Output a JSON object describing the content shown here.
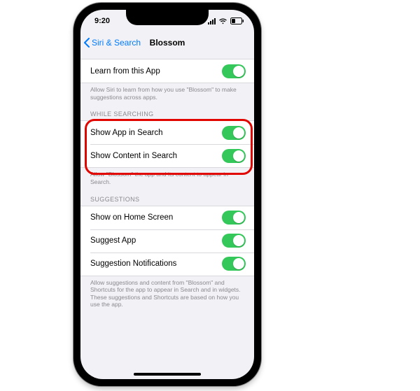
{
  "statusbar": {
    "time": "9:20"
  },
  "nav": {
    "back_label": "Siri & Search",
    "title": "Blossom"
  },
  "learn_section": {
    "row_label": "Learn from this App",
    "footer": "Allow Siri to learn from how you use \"Blossom\" to make suggestions across apps."
  },
  "searching_section": {
    "header": "WHILE SEARCHING",
    "rows": {
      "show_app": "Show App in Search",
      "show_content": "Show Content in Search"
    },
    "footer": "Allow \"Blossom\" the app and its content to appear in Search."
  },
  "suggestions_section": {
    "header": "SUGGESTIONS",
    "rows": {
      "home": "Show on Home Screen",
      "suggest": "Suggest App",
      "notifications": "Suggestion Notifications"
    },
    "footer": "Allow suggestions and content from \"Blossom\" and Shortcuts for the app to appear in Search and in widgets. These suggestions and Shortcuts are based on how you use the app."
  }
}
